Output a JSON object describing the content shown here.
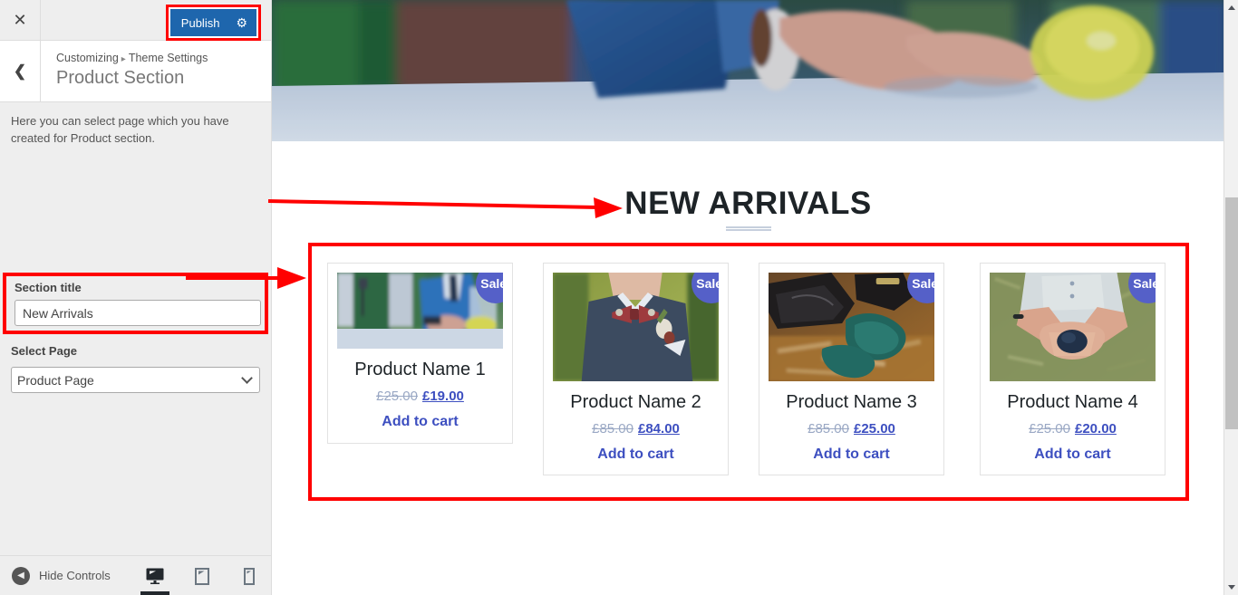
{
  "customizer": {
    "close_icon": "close-icon",
    "publish_label": "Publish",
    "publish_gear_icon": "gear-icon",
    "back_icon": "chevron-left-icon",
    "breadcrumb_root": "Customizing",
    "breadcrumb_sep": "▸",
    "breadcrumb_parent": "Theme Settings",
    "panel_title": "Product Section",
    "description": "Here you can select page which you have created for Product section.",
    "fields": {
      "section_title_label": "Section title",
      "section_title_value": "New Arrivals",
      "section_title_placeholder": "Section title",
      "select_page_label": "Select Page",
      "select_page_value": "Product Page",
      "select_page_options": [
        "Product Page"
      ]
    },
    "footer": {
      "hide_controls_label": "Hide Controls",
      "hide_controls_icon": "chevron-left-circle-icon",
      "devices": [
        {
          "name": "desktop-preview",
          "icon": "desktop-icon",
          "active": true
        },
        {
          "name": "tablet-preview",
          "icon": "tablet-icon",
          "active": false
        },
        {
          "name": "mobile-preview",
          "icon": "mobile-icon",
          "active": false
        }
      ]
    }
  },
  "preview": {
    "hero_image_alt": "man-in-blue-suit-at-table-with-lemonade",
    "section_heading": "NEW ARRIVALS",
    "products": [
      {
        "name": "Product Name 1",
        "badge": "Sale!",
        "old_price": "£25.00",
        "new_price": "£19.00",
        "add_to_cart": "Add to cart",
        "image_alt": "man-in-blue-suit-outdoors"
      },
      {
        "name": "Product Name 2",
        "badge": "Sale!",
        "old_price": "£85.00",
        "new_price": "£84.00",
        "add_to_cart": "Add to cart",
        "image_alt": "groom-with-bowtie-and-boutonniere"
      },
      {
        "name": "Product Name 3",
        "badge": "Sale!",
        "old_price": "£85.00",
        "new_price": "£25.00",
        "add_to_cart": "Add to cart",
        "image_alt": "black-shoes-and-green-tie-on-wood"
      },
      {
        "name": "Product Name 4",
        "badge": "Sale!",
        "old_price": "£25.00",
        "new_price": "£20.00",
        "add_to_cart": "Add to cart",
        "image_alt": "hands-holding-dark-stone-on-grass"
      }
    ]
  },
  "colors": {
    "annotation": "#ff0000",
    "publish_blue": "#1e66ad",
    "sale_badge": "#5560c8",
    "price_link": "#3d4fc0",
    "old_price": "#9aa8c4"
  }
}
